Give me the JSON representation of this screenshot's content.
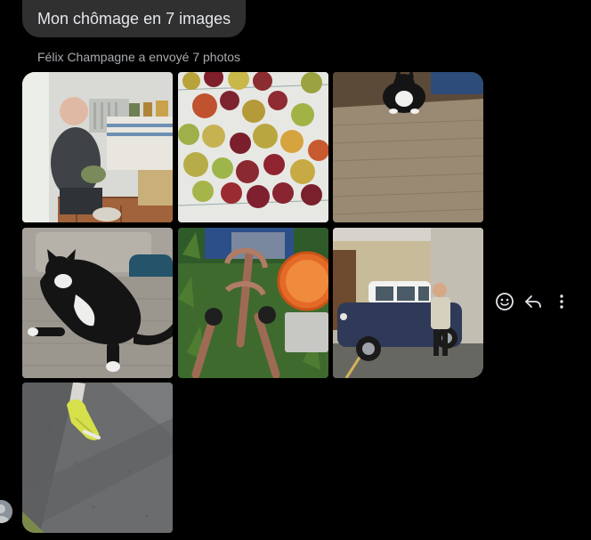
{
  "message": {
    "text": "Mon chômage en 7 images",
    "sender_line": "Félix Champagne a envoyé 7 photos"
  },
  "photos": [
    {
      "subject": "older man sitting in a kitchen"
    },
    {
      "subject": "apples on newspaper"
    },
    {
      "subject": "black and white cat on rug"
    },
    {
      "subject": "black and white cat on couch"
    },
    {
      "subject": "rusty tool and orange bowl"
    },
    {
      "subject": "person next to navy mini car"
    },
    {
      "subject": "yellow shoe on asphalt"
    }
  ],
  "actions": {
    "react_icon": "smiley-icon",
    "reply_icon": "reply-arrow-icon",
    "more_icon": "vertical-ellipsis-icon"
  },
  "colors": {
    "background": "#000000",
    "bubble": "#303030",
    "text": "#e4e6eb",
    "meta": "#a8abaf",
    "icon": "#e4e6eb"
  }
}
